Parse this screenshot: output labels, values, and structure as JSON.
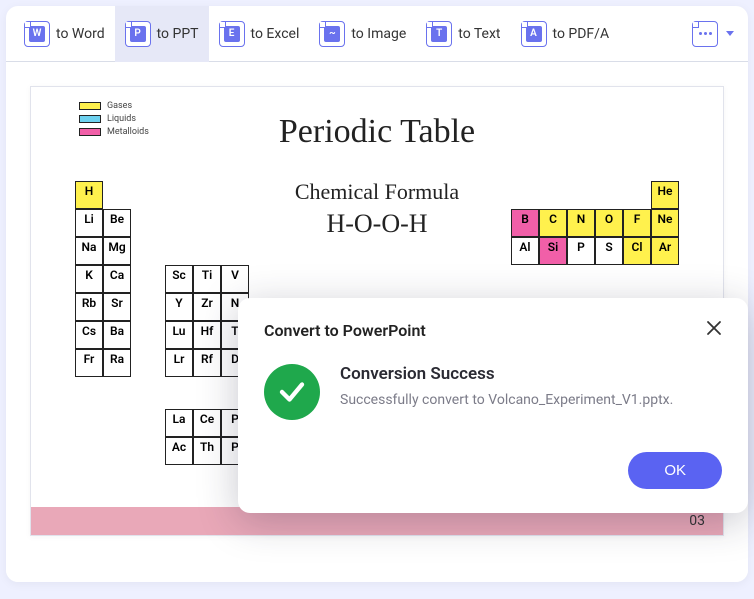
{
  "toolbar": {
    "items": [
      {
        "glyph": "W",
        "label": "to Word"
      },
      {
        "glyph": "P",
        "label": "to PPT"
      },
      {
        "glyph": "E",
        "label": "to Excel"
      },
      {
        "glyph": "~",
        "label": "to Image"
      },
      {
        "glyph": "T",
        "label": "to Text"
      },
      {
        "glyph": "A",
        "label": "to PDF/A"
      }
    ]
  },
  "document": {
    "legend": {
      "gases": "Gases",
      "liquids": "Liquids",
      "metalloids": "Metalloids"
    },
    "title": "Periodic Table",
    "subtitle": "Chemical Formula",
    "formula": "H-O-O-H",
    "page_number": "03",
    "elements_left": [
      "H",
      "",
      "Li",
      "Be",
      "Na",
      "Mg",
      "K",
      "Ca",
      "Rb",
      "Sr",
      "Cs",
      "Ba",
      "Fr",
      "Ra"
    ],
    "elements_right": [
      "",
      "",
      "",
      "",
      "",
      "He",
      "B",
      "C",
      "N",
      "O",
      "F",
      "Ne",
      "Al",
      "Si",
      "P",
      "S",
      "Cl",
      "Ar"
    ],
    "elements_mid_row1": [
      "Sc",
      "Ti",
      "V",
      "",
      "",
      "",
      "",
      "",
      "",
      ""
    ],
    "elements_mid_row2": [
      "Y",
      "Zr",
      "N",
      "",
      "",
      "",
      "",
      "",
      "",
      ""
    ],
    "elements_mid_row3": [
      "Lu",
      "Hf",
      "T",
      "",
      "",
      "",
      "",
      "",
      "",
      ""
    ],
    "elements_mid_row4": [
      "Lr",
      "Rf",
      "D",
      "",
      "",
      "",
      "",
      "",
      "",
      ""
    ],
    "elements_bot_row1": [
      "La",
      "Ce",
      "P",
      "",
      "",
      "",
      "",
      "",
      "",
      ""
    ],
    "elements_bot_row2": [
      "Ac",
      "Th",
      "P",
      "",
      "",
      "",
      "",
      "",
      "",
      ""
    ]
  },
  "modal": {
    "title": "Convert to PowerPoint",
    "main_text": "Conversion Success",
    "sub_text": "Successfully convert to Volcano_Experiment_V1.pptx.",
    "ok_label": "OK"
  }
}
